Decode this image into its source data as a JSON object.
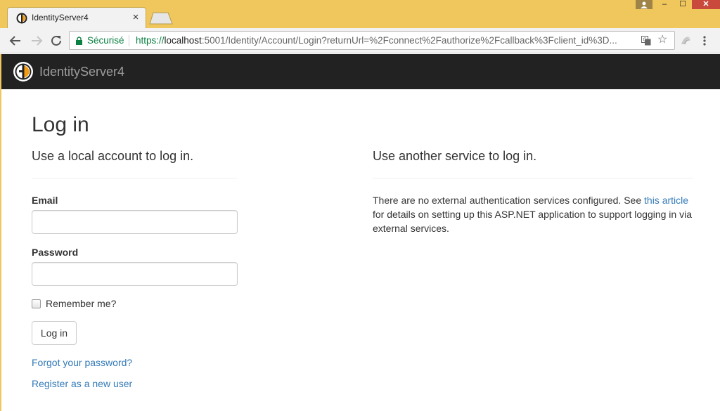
{
  "browser": {
    "tab_title": "IdentityServer4",
    "tab_close": "×",
    "secure_label": "Sécurisé",
    "url_scheme": "https://",
    "url_host": "localhost",
    "url_rest": ":5001/Identity/Account/Login?returnUrl=%2Fconnect%2Fauthorize%2Fcallback%3Fclient_id%3D...",
    "window_close": "✕",
    "window_minimize": "–",
    "window_maximize": "☐"
  },
  "navbar": {
    "brand": "IdentityServer4"
  },
  "page": {
    "title": "Log in",
    "local_heading": "Use a local account to log in.",
    "external_heading": "Use another service to log in.",
    "email_label": "Email",
    "email_value": "",
    "password_label": "Password",
    "password_value": "",
    "remember_label": "Remember me?",
    "remember_checked": false,
    "login_button": "Log in",
    "forgot_link": "Forgot your password?",
    "register_link": "Register as a new user",
    "external_text_before": "There are no external authentication services configured. See ",
    "external_link": "this article",
    "external_text_after": " for details on setting up this ASP.NET application to support logging in via external services."
  },
  "colors": {
    "titlebar": "#f0c75d",
    "navbar": "#222222",
    "link": "#337ab7",
    "secure": "#0b8043"
  }
}
